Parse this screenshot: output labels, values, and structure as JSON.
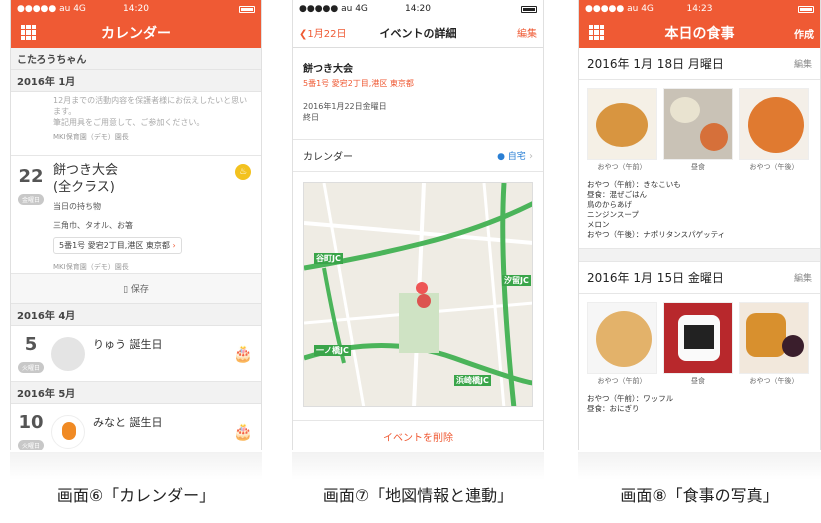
{
  "screen1": {
    "status": {
      "carrier": "●●●●● au  4G",
      "time": "14:20"
    },
    "title": "カレンダー",
    "child_name": "こたろうちゃん",
    "month1": "2016年 1月",
    "prev_event_text": "12月までの活動内容を保護者様にお伝えしたいと思います。\n筆記用具をご用意して、ご参加ください。",
    "prev_event_org": "MKI保育園（デモ）園長",
    "event": {
      "day": "22",
      "dow": "金曜日",
      "title": "餅つき大会\n(全クラス)",
      "bring_label": "当日の持ち物",
      "items": "三角巾、タオル、お箸",
      "address": "5番1号 愛宕2丁目,港区 東京都",
      "org": "MKI保育園（デモ）園長"
    },
    "save_label": "保存",
    "month2": "2016年 4月",
    "bday1": {
      "day": "5",
      "dow": "火曜日",
      "name": "りゅう 誕生日"
    },
    "month3": "2016年 5月",
    "bday2": {
      "day": "10",
      "dow": "火曜日",
      "name": "みなと 誕生日"
    }
  },
  "screen2": {
    "status": {
      "carrier": "●●●●● au  4G",
      "time": "14:20"
    },
    "back_label": "1月22日",
    "title": "イベントの詳細",
    "edit_label": "編集",
    "event_title": "餅つき大会",
    "event_address": "5番1号 愛宕2丁目,港区 東京都",
    "event_date": "2016年1月22日金曜日\n終日",
    "calendar_label": "カレンダー",
    "calendar_value": "自宅",
    "map_labels": {
      "jc1": "谷町JC",
      "jc2": "汐留JC",
      "jc3": "一ノ橋JC",
      "jc4": "浜崎橋JC"
    },
    "delete_label": "イベントを削除"
  },
  "screen3": {
    "status": {
      "carrier": "●●●●● au  4G",
      "time": "14:23"
    },
    "title": "本日の食事",
    "create_label": "作成",
    "day1": {
      "date": "2016年 1月 18日 月曜日",
      "edit": "編集",
      "captions": [
        "おやつ（午前）",
        "昼食",
        "おやつ（午後）"
      ],
      "menu": "おやつ（午前）：きなこいも\n昼食：混ぜごはん\n鳥のからあげ\nニンジンスープ\nメロン\nおやつ（午後）：ナポリタンスパゲッティ"
    },
    "day2": {
      "date": "2016年 1月 15日 金曜日",
      "edit": "編集",
      "captions": [
        "おやつ（午前）",
        "昼食",
        "おやつ（午後）"
      ],
      "menu": "おやつ（午前）：ワッフル\n昼食：おにぎり"
    }
  },
  "captions": {
    "c1": "画面⑥「カレンダー」",
    "c2": "画面⑦「地図情報と連動」",
    "c3": "画面⑧「食事の写真」"
  },
  "colors": {
    "accent": "#ef5a34",
    "blue": "#2a7fd4"
  }
}
